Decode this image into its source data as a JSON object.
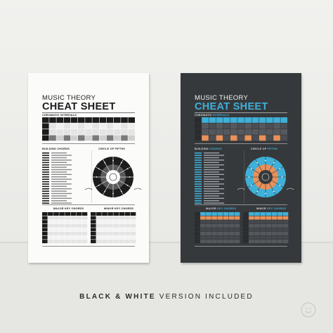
{
  "caption": {
    "bold_part": "BLACK & WHITE",
    "rest": "VERSION INCLUDED"
  },
  "posters": {
    "white": {
      "title_small": "MUSIC THEORY",
      "title_big": "CHEAT SHEET",
      "section_intervals_a": "CHROMATIC",
      "section_intervals_b": "INTERVALS",
      "section_chords_a": "BUILDING",
      "section_chords_b": "CHORDS",
      "section_circle_a": "CIRCLE OF",
      "section_circle_b": "FIFTHS",
      "section_major_a": "MAJOR",
      "section_major_b": "KEY CHORDS",
      "section_minor_a": "MINOR",
      "section_minor_b": "KEY CHORDS"
    },
    "dark": {
      "title_small": "MUSIC THEORY",
      "title_big": "CHEAT SHEET",
      "section_intervals_a": "CHROMATIC",
      "section_intervals_b": "INTERVALS",
      "section_chords_a": "BUILDING",
      "section_chords_b": "CHORDS",
      "section_circle_a": "CIRCLE OF",
      "section_circle_b": "FIFTHS",
      "section_major_a": "MAJOR",
      "section_major_b": "KEY CHORDS",
      "section_minor_a": "MINOR",
      "section_minor_b": "KEY CHORDS"
    }
  },
  "colors": {
    "dark_poster_bg": "#36393c",
    "accent_blue": "#3fb0d8",
    "accent_orange": "#e8915a",
    "white_poster_bg": "#fbfbfa"
  },
  "icons": {
    "logo": "face-logo-icon"
  }
}
